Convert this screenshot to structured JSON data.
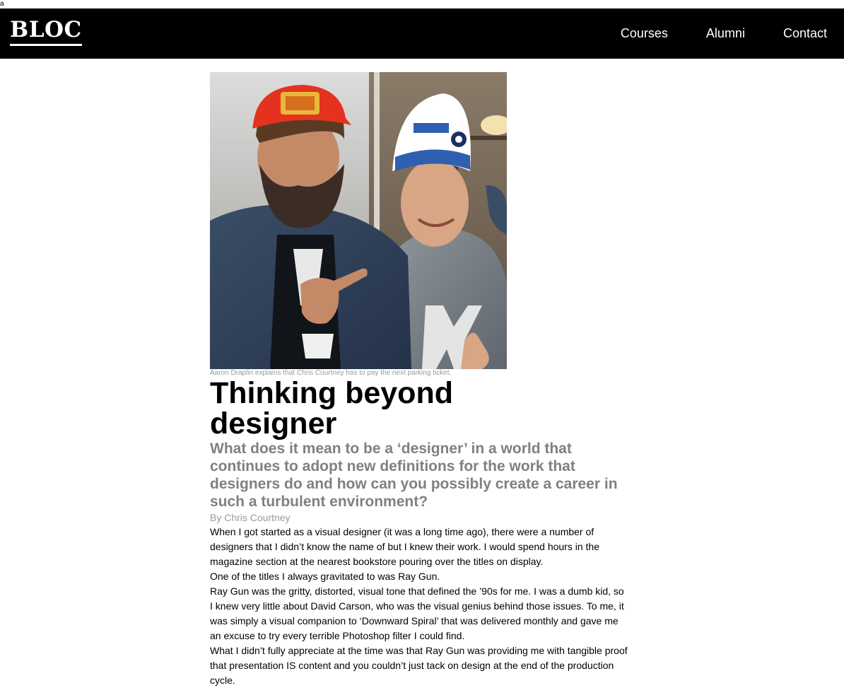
{
  "stray_text": "a",
  "header": {
    "logo": "BLOC",
    "nav": [
      "Courses",
      "Alumni",
      "Contact"
    ]
  },
  "article": {
    "caption": "Aaron Draplin explains that Chris Courtney has to pay the next parking ticket.",
    "title": "Thinking beyond designer",
    "subtitle": "What does it mean to be a ‘designer’ in a world that continues to adopt new definitions for the work that designers do and how can you possibly create a career in such a turbulent environment?",
    "byline": "By Chris Courtney",
    "paragraphs": [
      "When I got started as a visual designer (it was a long time ago), there were a number of designers that I didn’t know the name of but I knew their work. I would spend hours in the magazine section at the nearest bookstore pouring over the titles on display.",
      "One of the titles I always gravitated to was Ray Gun.",
      "Ray Gun was the gritty, distorted, visual tone that defined the ’90s for me. I was a dumb kid, so I knew very little about David Carson, who was the visual genius behind those issues. To me, it was simply a visual companion to ‘Downward Spiral’ that was delivered monthly and gave me an excuse to try every terrible Photoshop filter I could find.",
      "What I didn’t fully appreciate at the time was that Ray Gun was providing me with tangible proof that presentation IS content and you couldn’t just tack on design at the end of the production cycle."
    ]
  },
  "colors": {
    "navbar_bg": "#000000",
    "nav_text": "#ffffff",
    "subtitle": "#808080",
    "caption": "#9a9a9a"
  }
}
